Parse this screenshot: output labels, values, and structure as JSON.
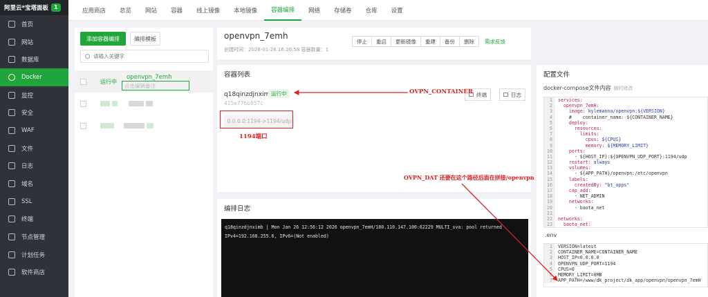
{
  "brand": {
    "title": "阿里云*宝塔面板",
    "badge": "1"
  },
  "sidebar": {
    "items": [
      {
        "label": "首页",
        "icon": "home-icon"
      },
      {
        "label": "网站",
        "icon": "website-icon"
      },
      {
        "label": "数据库",
        "icon": "database-icon"
      },
      {
        "label": "Docker",
        "icon": "docker-icon"
      },
      {
        "label": "监控",
        "icon": "monitor-icon"
      },
      {
        "label": "安全",
        "icon": "shield-icon"
      },
      {
        "label": "WAF",
        "icon": "waf-icon"
      },
      {
        "label": "文件",
        "icon": "folder-icon"
      },
      {
        "label": "日志",
        "icon": "log-icon"
      },
      {
        "label": "域名",
        "icon": "domain-icon"
      },
      {
        "label": "SSL",
        "icon": "ssl-icon"
      },
      {
        "label": "终端",
        "icon": "terminal-icon"
      },
      {
        "label": "节点管理",
        "icon": "node-icon"
      },
      {
        "label": "计划任务",
        "icon": "clock-icon"
      },
      {
        "label": "软件商店",
        "icon": "store-icon"
      }
    ]
  },
  "topnav": {
    "tabs": [
      "应用商店",
      "总览",
      "网站",
      "容器",
      "线上镜像",
      "本地镜像",
      "容器编排",
      "网络",
      "存储卷",
      "仓库",
      "设置"
    ]
  },
  "left": {
    "add_btn": "添加容器编排",
    "template_btn": "编排模板",
    "search_placeholder": "请输入关键字",
    "project": {
      "status": "运行中",
      "name": "openvpn_7emh",
      "remark": "点击编辑备注"
    }
  },
  "project_header": {
    "title": "openvpn_7emh",
    "meta": "创建时间：2026-01-26 16:26:58     容器数量：1",
    "actions": [
      "停止",
      "重启",
      "更新镜像",
      "重建",
      "备份",
      "删除"
    ],
    "feedback": "需求反馈"
  },
  "containers": {
    "title": "容器列表",
    "name": "q18qinzdjnximb",
    "status": "运行中",
    "id": "415e776b857c",
    "port": "0.0.0.0:1194->1194/udp",
    "terminal_btn": "终端",
    "log_btn": "日志"
  },
  "logs": {
    "title": "编排日志",
    "lines": [
      "q18qinzdjnximb | Mon Jan 26 12:56:12 2026 openvpn_7emH/180.110.147.100:62229 MULTI_sva: pool returned",
      "IPv4=192.168.255.6, IPv6=(Not enabled)"
    ]
  },
  "config": {
    "title": "配置文件",
    "compose_label": "docker-compose文件内容",
    "compose_hint": "随时修改",
    "compose_lines": [
      "services:",
      "  openvpn_7emH:",
      "    image: kylemanna/openvpn:${VERSION}",
      "    #    container_name: ${CONTAINER_NAME}",
      "    deploy:",
      "      resources:",
      "        limits:",
      "          cpus: ${CPUS}",
      "          memory: ${MEMORY_LIMIT}",
      "    ports:",
      "      - ${HOST_IP}:${OPENVPN_UDP_PORT}:1194/udp",
      "    restart: always",
      "    volumes:",
      "      - ${APP_PATH}/openvpn:/etc/openvpn",
      "    labels:",
      "      createdBy: \"bt_apps\"",
      "    cap_add:",
      "      - NET_ADMIN",
      "    networks:",
      "      - baota_net",
      "",
      "networks:",
      "  baota_net:"
    ],
    "env_label": ".env",
    "env_lines": [
      "VERSION=latest",
      "CONTAINER_NAME=CONTAINER_NAME",
      "HOST_IP=0.0.0.0",
      "OPENVPN_UDP_PORT=1194",
      "CPUS=0",
      "MEMORY_LIMIT=0MB",
      "APP_PATH=/www/dk_project/dk_app/openvpn/openvpn_7emH"
    ]
  },
  "annotations": {
    "container": "OVPN_CONTAINER",
    "port": "1194端口",
    "dat": "OVPN_DAT  还要在这个路径后面在拼接/openvpn"
  },
  "colors": {
    "accent": "#20a53a",
    "annotation": "#e02020",
    "sidebar": "#2f3339"
  }
}
